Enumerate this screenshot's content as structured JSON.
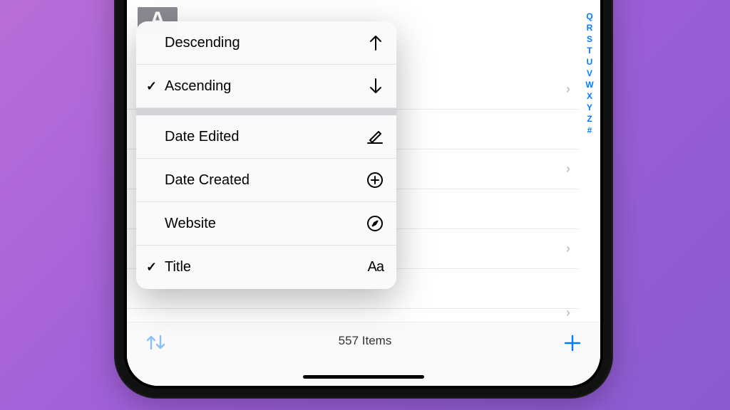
{
  "section_header_letter": "A",
  "menu": {
    "direction": {
      "descending": {
        "label": "Descending",
        "checked": false,
        "icon": "arrow-up-icon"
      },
      "ascending": {
        "label": "Ascending",
        "checked": true,
        "icon": "arrow-down-icon"
      }
    },
    "sort_by": {
      "date_edited": {
        "label": "Date Edited",
        "checked": false,
        "icon": "pencil-icon"
      },
      "date_created": {
        "label": "Date Created",
        "checked": false,
        "icon": "plus-circle-icon"
      },
      "website": {
        "label": "Website",
        "checked": false,
        "icon": "compass-icon"
      },
      "title": {
        "label": "Title",
        "checked": true,
        "icon": "textformat-icon"
      }
    }
  },
  "toolbar": {
    "item_count": "557 Items"
  },
  "index_letters": [
    "Q",
    "R",
    "S",
    "T",
    "U",
    "V",
    "W",
    "X",
    "Y",
    "Z",
    "#"
  ],
  "checkmark": "✓",
  "aa_glyph": "Aa"
}
